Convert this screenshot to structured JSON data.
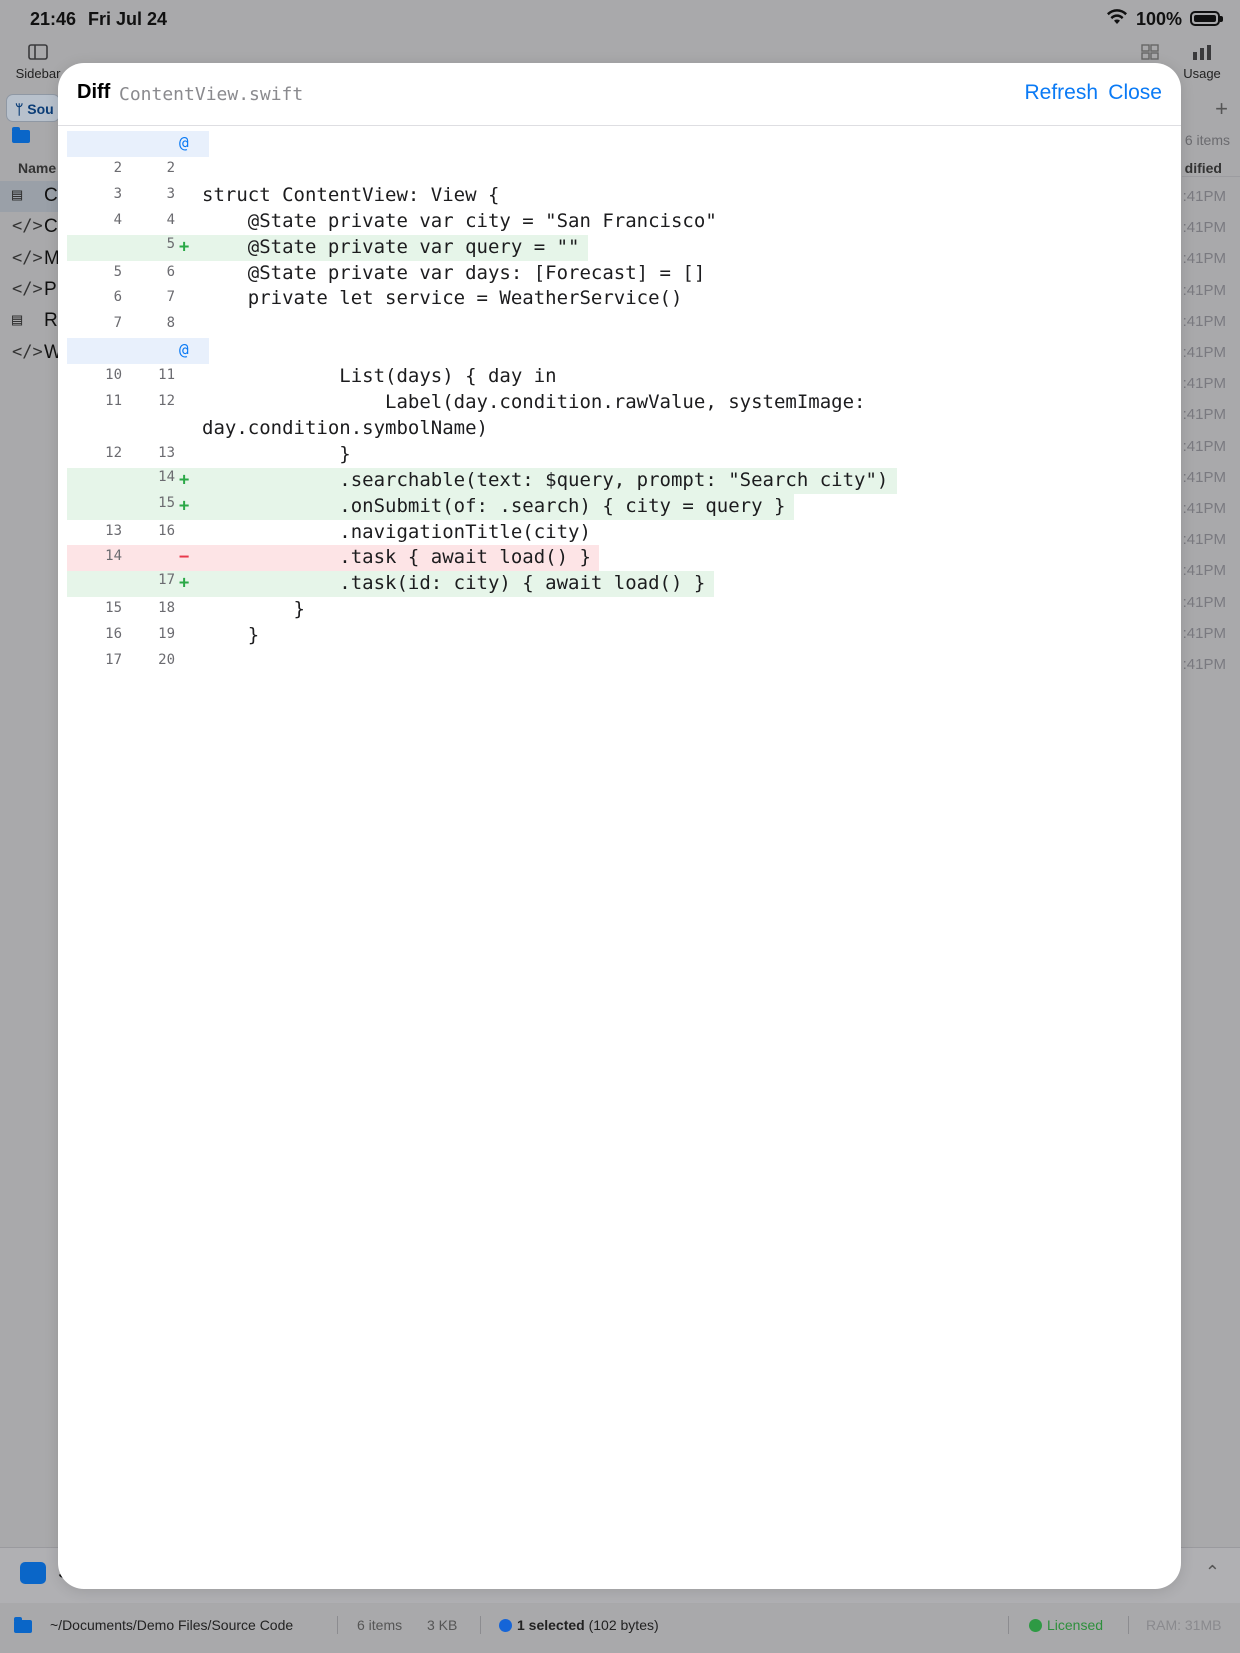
{
  "status_bar": {
    "time": "21:46",
    "date": "Fri Jul 24",
    "battery": "100%"
  },
  "background": {
    "toolbar": {
      "sidebar_label": "Sidebar",
      "usage_label": "Usage"
    },
    "tab_label": "Sou",
    "items_count": "6 items",
    "columns": {
      "name": "Name",
      "modified": "dified"
    },
    "files": [
      {
        "icon": "doc-icon",
        "glyph": "▤",
        "letter": "C"
      },
      {
        "icon": "code-icon",
        "glyph": "</>",
        "letter": "C"
      },
      {
        "icon": "code-icon",
        "glyph": "</>",
        "letter": "M"
      },
      {
        "icon": "code-icon",
        "glyph": "</>",
        "letter": "P"
      },
      {
        "icon": "doc-icon",
        "glyph": "▤",
        "letter": "R"
      },
      {
        "icon": "code-icon",
        "glyph": "</>",
        "letter": "W"
      }
    ],
    "times": [
      ":41PM",
      ":41PM",
      ":41PM",
      ":41PM",
      ":41PM",
      ":41PM",
      ":41PM",
      ":41PM",
      ":41PM",
      ":41PM",
      ":41PM",
      ":41PM",
      ":41PM",
      ":41PM",
      ":41PM",
      ":41PM"
    ],
    "bottom_panel_letter": "S",
    "footer": {
      "path": "~/Documents/Demo Files/Source Code",
      "items": "6 items",
      "size": "3 KB",
      "selected_bold": "1 selected",
      "selected_rest": "(102 bytes)",
      "license": "Licensed",
      "ram": "RAM: 31MB"
    }
  },
  "sheet": {
    "title": "Diff",
    "filename": "ContentView.swift",
    "refresh_label": "Refresh",
    "close_label": "Close"
  },
  "diff_lines": [
    {
      "type": "hunk",
      "old": "",
      "new": "",
      "sign": "@",
      "text": ""
    },
    {
      "type": "ctx",
      "old": "2",
      "new": "2",
      "sign": "",
      "text": ""
    },
    {
      "type": "ctx",
      "old": "3",
      "new": "3",
      "sign": "",
      "text": "struct ContentView: View {"
    },
    {
      "type": "ctx",
      "old": "4",
      "new": "4",
      "sign": "",
      "text": "    @State private var city = \"San Francisco\""
    },
    {
      "type": "add",
      "old": "",
      "new": "5",
      "sign": "+",
      "text": "    @State private var query = \"\""
    },
    {
      "type": "ctx",
      "old": "5",
      "new": "6",
      "sign": "",
      "text": "    @State private var days: [Forecast] = []"
    },
    {
      "type": "ctx",
      "old": "6",
      "new": "7",
      "sign": "",
      "text": "    private let service = WeatherService()"
    },
    {
      "type": "ctx",
      "old": "7",
      "new": "8",
      "sign": "",
      "text": ""
    },
    {
      "type": "hunk",
      "old": "",
      "new": "",
      "sign": "@",
      "text": ""
    },
    {
      "type": "ctx",
      "old": "10",
      "new": "11",
      "sign": "",
      "text": "            List(days) { day in"
    },
    {
      "type": "ctx",
      "old": "11",
      "new": "12",
      "sign": "",
      "text": "                Label(day.condition.rawValue, systemImage:",
      "cont": "day.condition.symbolName)"
    },
    {
      "type": "ctx",
      "old": "12",
      "new": "13",
      "sign": "",
      "text": "            }"
    },
    {
      "type": "add",
      "old": "",
      "new": "14",
      "sign": "+",
      "text": "            .searchable(text: $query, prompt: \"Search city\")"
    },
    {
      "type": "add",
      "old": "",
      "new": "15",
      "sign": "+",
      "text": "            .onSubmit(of: .search) { city = query }"
    },
    {
      "type": "ctx",
      "old": "13",
      "new": "16",
      "sign": "",
      "text": "            .navigationTitle(city)"
    },
    {
      "type": "del",
      "old": "14",
      "new": "",
      "sign": "−",
      "text": "            .task { await load() }"
    },
    {
      "type": "add",
      "old": "",
      "new": "17",
      "sign": "+",
      "text": "            .task(id: city) { await load() }"
    },
    {
      "type": "ctx",
      "old": "15",
      "new": "18",
      "sign": "",
      "text": "        }"
    },
    {
      "type": "ctx",
      "old": "16",
      "new": "19",
      "sign": "",
      "text": "    }"
    },
    {
      "type": "ctx",
      "old": "17",
      "new": "20",
      "sign": "",
      "text": ""
    }
  ],
  "colors": {
    "accent": "#0a7af5",
    "added_bg": "#e6f5e9",
    "removed_bg": "#fde4e6",
    "hunk_bg": "#e8f0fc",
    "added_sign": "#2aa846",
    "removed_sign": "#e8394c"
  }
}
